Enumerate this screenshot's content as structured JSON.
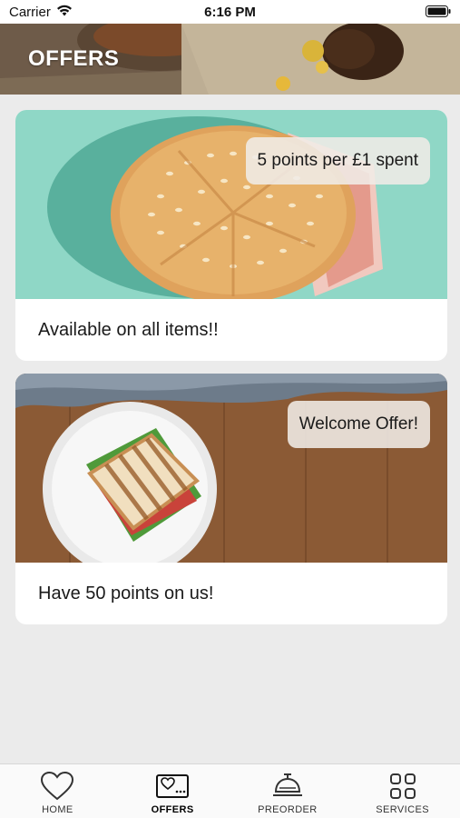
{
  "status_bar": {
    "carrier": "Carrier",
    "time": "6:16 PM"
  },
  "header": {
    "title": "OFFERS"
  },
  "offers": [
    {
      "badge": "5 points per £1 spent",
      "caption": "Available on all items!!",
      "image": "sesame-bun-sandwich-on-teal"
    },
    {
      "badge": "Welcome Offer!",
      "caption": "Have 50 points on us!",
      "image": "toasted-sandwich-on-plate-wood-table"
    }
  ],
  "tabs": [
    {
      "label": "HOME",
      "icon": "heart-icon",
      "active": false
    },
    {
      "label": "OFFERS",
      "icon": "offers-tag-icon",
      "active": true
    },
    {
      "label": "PREORDER",
      "icon": "service-bell-icon",
      "active": false
    },
    {
      "label": "SERVICES",
      "icon": "grid-icon",
      "active": false
    }
  ],
  "colors": {
    "background": "#ebebeb",
    "card": "#ffffff",
    "teal_image_bg": "#8fd7c6",
    "wood": "#8b5a35"
  }
}
